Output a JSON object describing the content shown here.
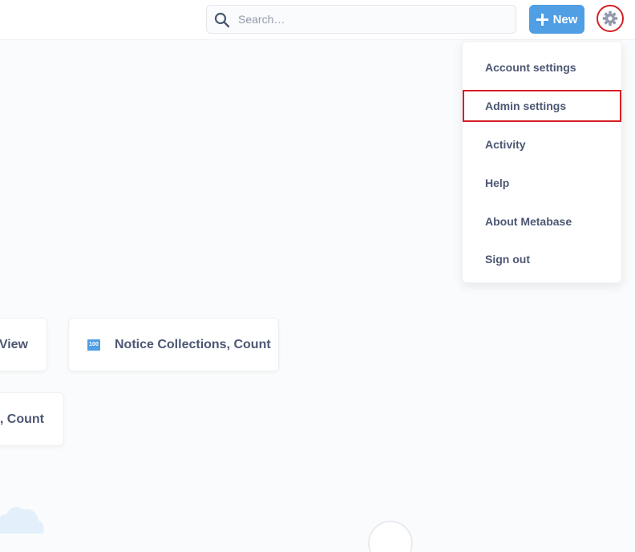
{
  "header": {
    "search": {
      "placeholder": "Search…",
      "value": ""
    },
    "new_button_label": "New",
    "settings_icon": "gear-icon"
  },
  "settings_menu": {
    "items": [
      {
        "label": "Account settings"
      },
      {
        "label": "Admin settings",
        "highlighted": true
      },
      {
        "label": "Activity"
      },
      {
        "label": "Help"
      },
      {
        "label": "About Metabase"
      },
      {
        "label": "Sign out"
      }
    ]
  },
  "cards": [
    {
      "label": "View"
    },
    {
      "label": "Notice Collections, Count",
      "icon_text": "100"
    },
    {
      "label": "s, Count"
    }
  ],
  "colors": {
    "accent": "#509ee3",
    "highlight_outline": "#d61f26",
    "text": "#4c5773",
    "background": "#f9fbfc"
  }
}
